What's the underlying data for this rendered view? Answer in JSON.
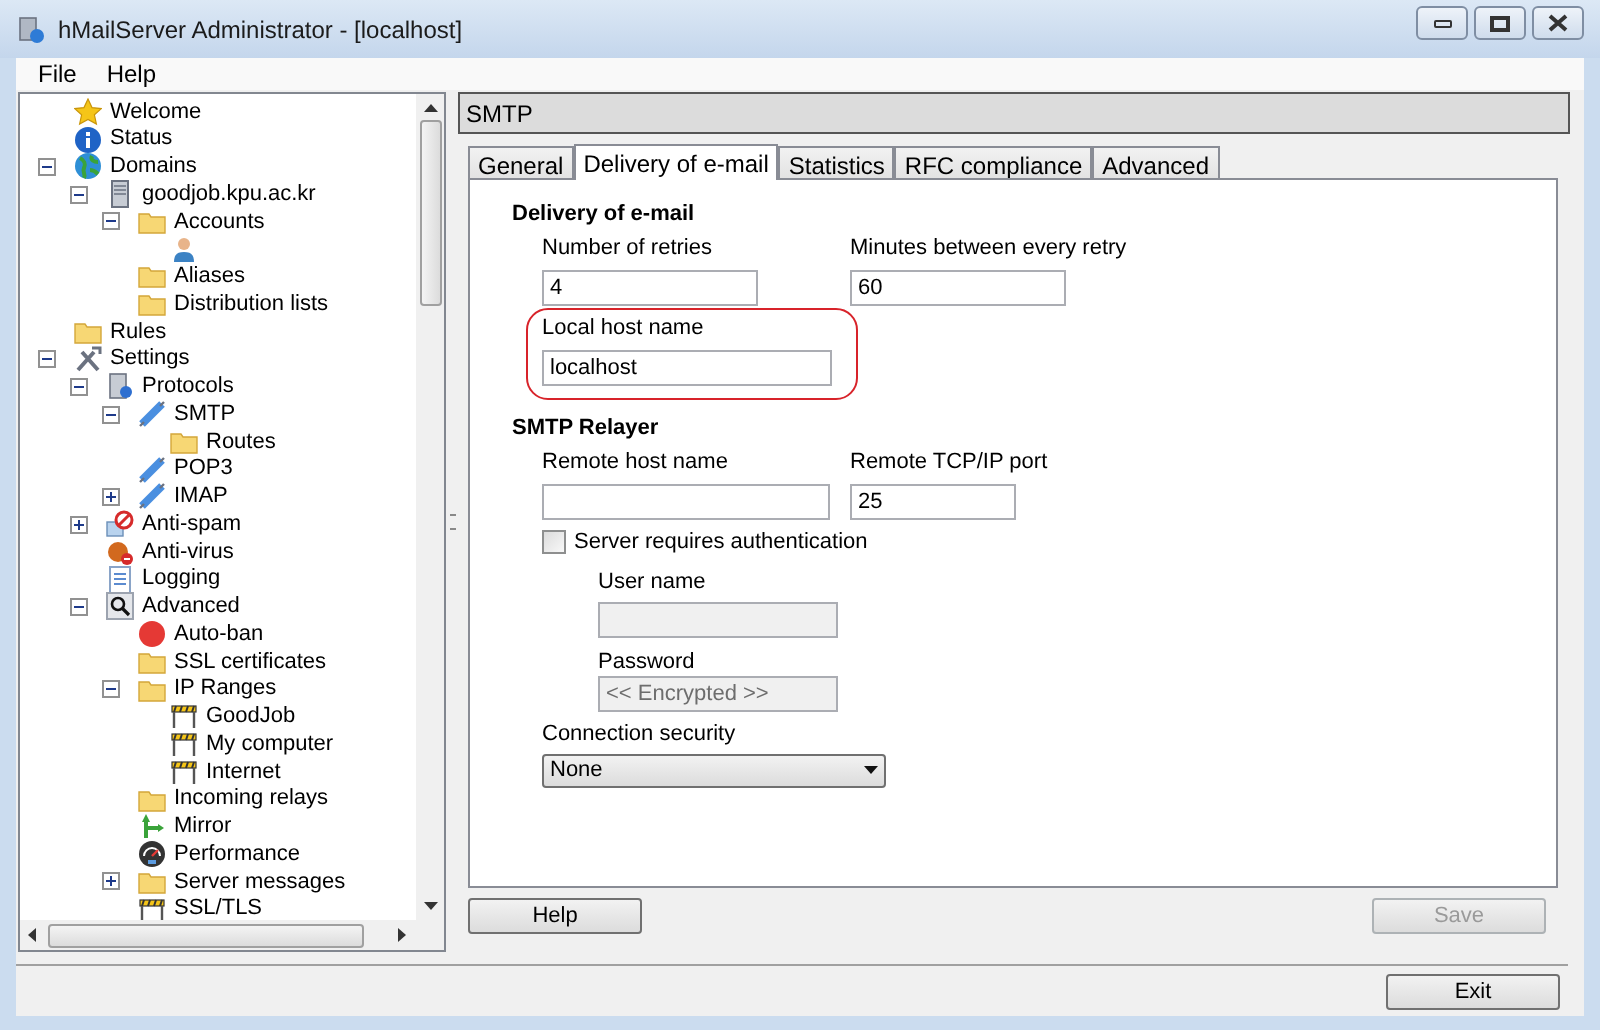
{
  "window": {
    "title": "hMailServer Administrator - [localhost]"
  },
  "menu": [
    {
      "label": "File"
    },
    {
      "label": "Help"
    }
  ],
  "tree": [
    {
      "label": "Welcome",
      "kind": "star"
    },
    {
      "label": "Status",
      "kind": "info"
    },
    {
      "label": "Domains",
      "kind": "globe",
      "expanded": true,
      "children": [
        {
          "label": "goodjob.kpu.ac.kr",
          "kind": "server",
          "expanded": true,
          "children": [
            {
              "label": "Accounts",
              "kind": "folder",
              "expanded": true,
              "children": [
                {
                  "kind": "user"
                }
              ]
            },
            {
              "label": "Aliases",
              "kind": "folder"
            },
            {
              "label": "Distribution lists",
              "kind": "folder"
            }
          ]
        }
      ]
    },
    {
      "label": "Rules",
      "kind": "folder"
    },
    {
      "label": "Settings",
      "kind": "tools",
      "expanded": true,
      "children": [
        {
          "label": "Protocols",
          "kind": "protocols",
          "expanded": true,
          "children": [
            {
              "label": "SMTP",
              "kind": "plug",
              "expanded": true,
              "children": [
                {
                  "label": "Routes",
                  "kind": "folder"
                }
              ]
            },
            {
              "label": "POP3",
              "kind": "plug"
            },
            {
              "label": "IMAP",
              "kind": "plug",
              "expanded": false
            }
          ]
        },
        {
          "label": "Anti-spam",
          "kind": "nospam",
          "expanded": false
        },
        {
          "label": "Anti-virus",
          "kind": "antivirus"
        },
        {
          "label": "Logging",
          "kind": "log"
        },
        {
          "label": "Advanced",
          "kind": "search",
          "expanded": true,
          "children": [
            {
              "label": "Auto-ban",
              "kind": "dot"
            },
            {
              "label": "SSL certificates",
              "kind": "folder"
            },
            {
              "label": "IP Ranges",
              "kind": "folder",
              "expanded": true,
              "children": [
                {
                  "label": "GoodJob",
                  "kind": "barrier"
                },
                {
                  "label": "My computer",
                  "kind": "barrier"
                },
                {
                  "label": "Internet",
                  "kind": "barrier"
                }
              ]
            },
            {
              "label": "Incoming relays",
              "kind": "folder"
            },
            {
              "label": "Mirror",
              "kind": "mirror"
            },
            {
              "label": "Performance",
              "kind": "gauge"
            },
            {
              "label": "Server messages",
              "kind": "folder",
              "expanded": false
            },
            {
              "label": "SSL/TLS",
              "kind": "barrier"
            }
          ]
        }
      ]
    }
  ],
  "panel": {
    "title": "SMTP",
    "tabs": [
      {
        "label": "General",
        "selected": false
      },
      {
        "label": "Delivery of e-mail",
        "selected": true
      },
      {
        "label": "Statistics",
        "selected": false
      },
      {
        "label": "RFC compliance",
        "selected": false
      },
      {
        "label": "Advanced",
        "selected": false
      }
    ],
    "delivery": {
      "heading": "Delivery of e-mail",
      "retries": {
        "label": "Number of retries",
        "value": "4"
      },
      "minutes": {
        "label": "Minutes between every retry",
        "value": "60"
      },
      "local_host": {
        "label": "Local host name",
        "value": "localhost",
        "highlighted": true
      }
    },
    "relayer": {
      "heading": "SMTP Relayer",
      "remote_host": {
        "label": "Remote host name"
      },
      "remote_port": {
        "label": "Remote TCP/IP port",
        "value": "25"
      },
      "auth": {
        "label": "Server requires authentication",
        "checked": false
      },
      "user_name": {
        "label": "User name",
        "disabled": true
      },
      "password": {
        "label": "Password",
        "value": "<< Encrypted >>",
        "disabled": true
      },
      "security": {
        "label": "Connection security",
        "value": "None"
      }
    },
    "help_button": {
      "label": "Help",
      "disabled": false
    },
    "save_button": {
      "label": "Save",
      "disabled": true
    }
  },
  "exit_button": {
    "label": "Exit"
  }
}
